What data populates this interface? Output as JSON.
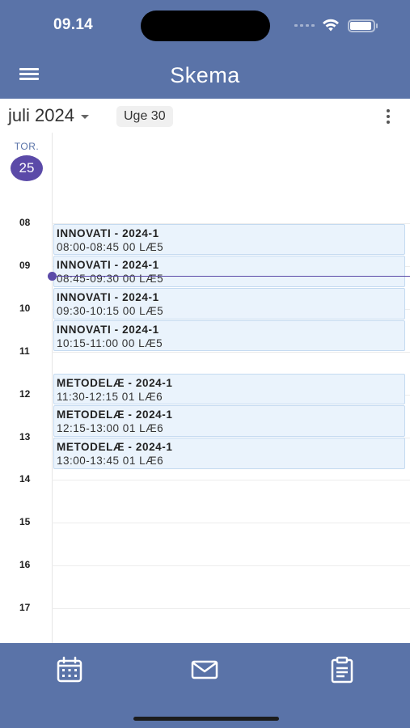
{
  "status_bar": {
    "time": "09.14"
  },
  "app_bar": {
    "title": "Skema"
  },
  "toolbar": {
    "month": "juli 2024",
    "week": "Uge 30"
  },
  "day": {
    "weekday": "TOR.",
    "date": "25"
  },
  "hours": [
    "08",
    "09",
    "10",
    "11",
    "12",
    "13",
    "14",
    "15",
    "16",
    "17"
  ],
  "events": [
    {
      "title": "INNOVATI - 2024-1",
      "details": "08:00-08:45 00 LÆ5",
      "start": "08:00",
      "end": "08:45"
    },
    {
      "title": "INNOVATI - 2024-1",
      "details": "08:45-09:30 00 LÆ5",
      "start": "08:45",
      "end": "09:30"
    },
    {
      "title": "INNOVATI - 2024-1",
      "details": "09:30-10:15 00 LÆ5",
      "start": "09:30",
      "end": "10:15"
    },
    {
      "title": "INNOVATI - 2024-1",
      "details": "10:15-11:00 00 LÆ5",
      "start": "10:15",
      "end": "11:00"
    },
    {
      "title": "METODELÆ - 2024-1",
      "details": "11:30-12:15 01 LÆ6",
      "start": "11:30",
      "end": "12:15"
    },
    {
      "title": "METODELÆ - 2024-1",
      "details": "12:15-13:00 01 LÆ6",
      "start": "12:15",
      "end": "13:00"
    },
    {
      "title": "METODELÆ - 2024-1",
      "details": "13:00-13:45 01 LÆ6",
      "start": "13:00",
      "end": "13:45"
    }
  ],
  "current_time": "09:14",
  "bottom_nav": [
    {
      "name": "calendar",
      "icon": "calendar-icon"
    },
    {
      "name": "messages",
      "icon": "mail-icon"
    },
    {
      "name": "assignments",
      "icon": "clipboard-icon"
    }
  ],
  "colors": {
    "primary": "#5a73a8",
    "accent": "#5b4aa8",
    "event_bg": "#eaf3fc",
    "event_border": "#c4daf0"
  }
}
